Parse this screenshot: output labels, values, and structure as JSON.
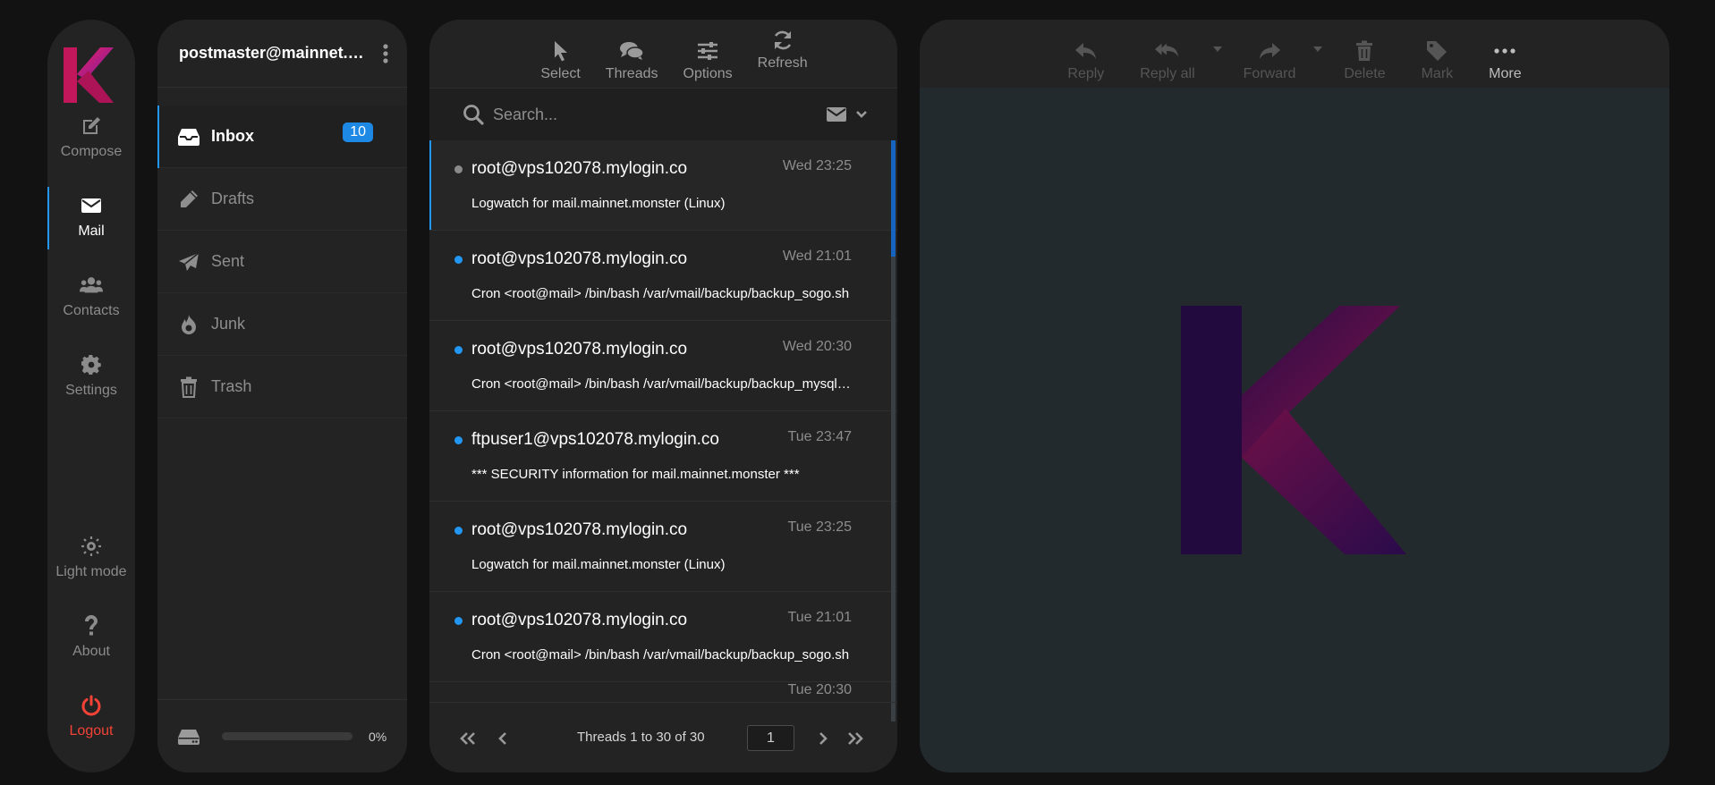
{
  "nav": {
    "compose": "Compose",
    "mail": "Mail",
    "contacts": "Contacts",
    "settings": "Settings",
    "light_mode": "Light mode",
    "about": "About",
    "logout": "Logout"
  },
  "account": {
    "email": "postmaster@mainnet.monster"
  },
  "folders": [
    {
      "label": "Inbox",
      "icon": "inbox-icon",
      "badge": "10"
    },
    {
      "label": "Drafts",
      "icon": "pencil-icon"
    },
    {
      "label": "Sent",
      "icon": "paper-plane-icon"
    },
    {
      "label": "Junk",
      "icon": "fire-icon"
    },
    {
      "label": "Trash",
      "icon": "trash-icon"
    }
  ],
  "quota": {
    "percent_label": "0%",
    "fraction": 0
  },
  "list_toolbar": {
    "select": "Select",
    "threads": "Threads",
    "options": "Options",
    "refresh": "Refresh"
  },
  "search": {
    "placeholder": "Search...",
    "value": ""
  },
  "messages": [
    {
      "from": "root@vps102078.mylogin.co",
      "date": "Wed 23:25",
      "subject": "Logwatch for mail.mainnet.monster (Linux)",
      "unread": false,
      "selected": true
    },
    {
      "from": "root@vps102078.mylogin.co",
      "date": "Wed 21:01",
      "subject": "Cron <root@mail> /bin/bash /var/vmail/backup/backup_sogo.sh",
      "unread": true
    },
    {
      "from": "root@vps102078.mylogin.co",
      "date": "Wed 20:30",
      "subject": "Cron <root@mail> /bin/bash /var/vmail/backup/backup_mysql.sh",
      "unread": true
    },
    {
      "from": "ftpuser1@vps102078.mylogin.co",
      "date": "Tue 23:47",
      "subject": "*** SECURITY information for mail.mainnet.monster ***",
      "unread": true
    },
    {
      "from": "root@vps102078.mylogin.co",
      "date": "Tue 23:25",
      "subject": "Logwatch for mail.mainnet.monster (Linux)",
      "unread": true
    },
    {
      "from": "root@vps102078.mylogin.co",
      "date": "Tue 21:01",
      "subject": "Cron <root@mail> /bin/bash /var/vmail/backup/backup_sogo.sh",
      "unread": true
    },
    {
      "from": "",
      "date": "Tue 20:30",
      "subject": "",
      "unread": true,
      "partial": true
    }
  ],
  "pager": {
    "info": "Threads 1 to 30 of 30",
    "page": "1"
  },
  "reader_toolbar": {
    "reply": "Reply",
    "reply_all": "Reply all",
    "forward": "Forward",
    "delete": "Delete",
    "mark": "Mark",
    "more": "More"
  },
  "colors": {
    "accent": "#2196f3",
    "badge": "#1e88e5",
    "logout": "#f44336",
    "logo_magenta": "#c2185b",
    "logo_purple": "#4a148c"
  }
}
